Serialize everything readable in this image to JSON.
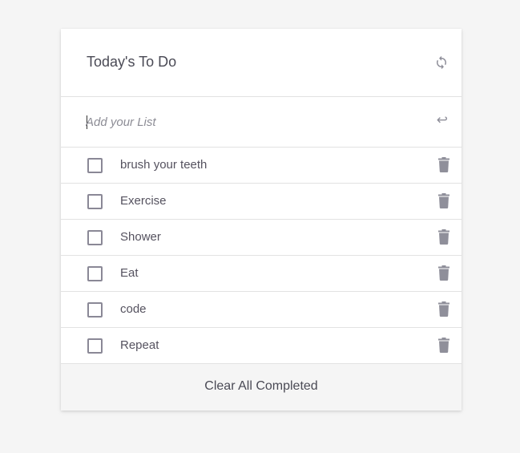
{
  "header": {
    "title": "Today's To Do",
    "refresh_icon": "refresh-icon"
  },
  "add": {
    "placeholder": "Add your List",
    "value": "",
    "enter_icon": "enter-icon",
    "enter_glyph": "↩"
  },
  "items": [
    {
      "label": "brush your teeth",
      "checked": false
    },
    {
      "label": "Exercise",
      "checked": false
    },
    {
      "label": "Shower",
      "checked": false
    },
    {
      "label": "Eat",
      "checked": false
    },
    {
      "label": "code",
      "checked": false
    },
    {
      "label": "Repeat",
      "checked": false
    }
  ],
  "footer": {
    "clear_label": "Clear All Completed"
  },
  "colors": {
    "background": "#f5f5f5",
    "card": "#ffffff",
    "icon": "#8f8f9a",
    "text": "#4a4a55",
    "divider": "#e2e2e2"
  }
}
